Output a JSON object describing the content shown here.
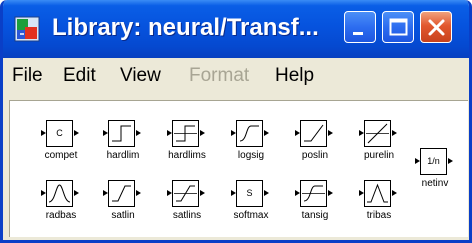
{
  "window": {
    "title": "Library: neural/Transf...",
    "colors": {
      "titlebar": "#0653de",
      "close_button": "#e2582e",
      "menu_disabled": "#a8a594"
    }
  },
  "menu": {
    "file": "File",
    "edit": "Edit",
    "view": "View",
    "format": "Format",
    "help": "Help"
  },
  "blocks": [
    {
      "name": "compet",
      "icon": "text-icon",
      "glyph": "C"
    },
    {
      "name": "hardlim",
      "icon": "hardlim-icon"
    },
    {
      "name": "hardlims",
      "icon": "hardlims-icon"
    },
    {
      "name": "logsig",
      "icon": "logsig-icon"
    },
    {
      "name": "poslin",
      "icon": "poslin-icon"
    },
    {
      "name": "purelin",
      "icon": "purelin-icon"
    },
    {
      "name": "netinv",
      "icon": "text-icon",
      "glyph": "1/n"
    },
    {
      "name": "radbas",
      "icon": "radbas-icon"
    },
    {
      "name": "satlin",
      "icon": "satlin-icon"
    },
    {
      "name": "satlins",
      "icon": "satlins-icon"
    },
    {
      "name": "softmax",
      "icon": "text-icon",
      "glyph": "S"
    },
    {
      "name": "tansig",
      "icon": "tansig-icon"
    },
    {
      "name": "tribas",
      "icon": "tribas-icon"
    }
  ]
}
